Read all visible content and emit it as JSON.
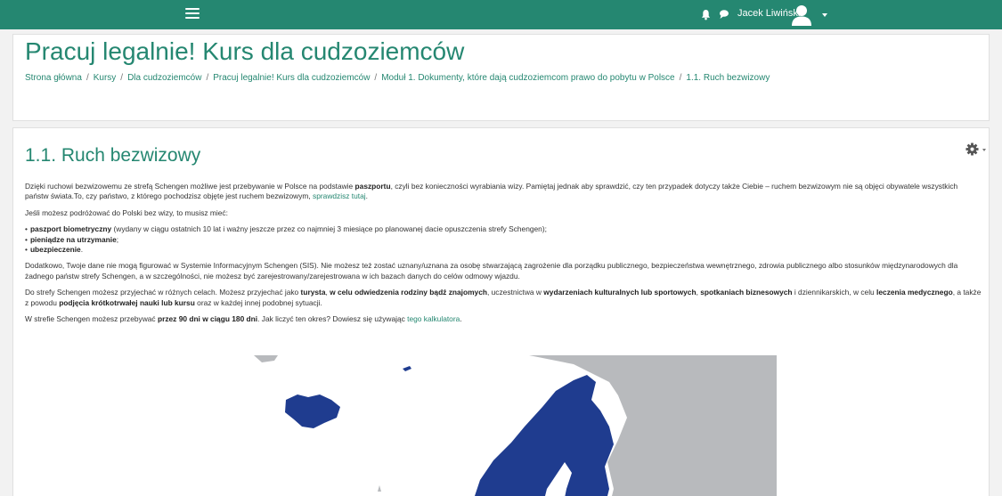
{
  "topbar": {
    "menu_icon": "hamburger-menu-icon",
    "user_name": "Jacek Liwiński",
    "icons": [
      "bell-icon",
      "chat-icon",
      "user-avatar-icon",
      "caret-down-icon"
    ]
  },
  "header": {
    "title": "Pracuj legalnie! Kurs dla cudzoziemców",
    "breadcrumb": [
      "Strona główna",
      "Kursy",
      "Dla cudzoziemców",
      "Pracuj legalnie! Kurs dla cudzoziemców",
      "Moduł 1. Dokumenty, które dają cudzoziemcom prawo do pobytu w Polsce",
      "1.1. Ruch bezwizowy"
    ],
    "separator": "/"
  },
  "content": {
    "title": "1.1. Ruch bezwizowy",
    "p1": {
      "t1": "Dzięki ruchowi bezwizowemu ze strefą Schengen możliwe jest przebywanie w Polsce na podstawie ",
      "b1": "paszportu",
      "t2": ", czyli bez konieczności wyrabiania wizy. Pamiętaj jednak aby sprawdzić, czy ten przypadek dotyczy także Ciebie – ruchem bezwizowym nie są objęci obywatele wszystkich państw świata.To, czy państwo, z którego pochodzisz objęte jest ruchem bezwizowym, ",
      "link": "sprawdzisz tutaj",
      "t3": "."
    },
    "p2": "Jeśli możesz podróżować do Polski bez wizy, to musisz mieć:",
    "list": {
      "i1_b": "paszport biometryczny",
      "i1_t": " (wydany w ciągu ostatnich 10 lat i ważny jeszcze przez co najmniej 3 miesiące po planowanej dacie opuszczenia strefy Schengen);",
      "i2_b": "pieniądze na utrzymanie",
      "i2_t": ";",
      "i3_b": "ubezpieczenie",
      "i3_t": "."
    },
    "p3": "Dodatkowo, Twoje dane nie mogą figurować w Systemie Informacyjnym Schengen (SIS). Nie możesz też zostać uznany/uznana za osobę stwarzającą zagrożenie dla porządku publicznego, bezpieczeństwa wewnętrznego, zdrowia publicznego albo stosunków międzynarodowych dla żadnego państw strefy Schengen, a w szczególności, nie możesz być zarejestrowany/zarejestrowana w ich bazach danych do celów odmowy wjazdu.",
    "p4": {
      "t1": "Do strefy Schengen możesz przyjechać w różnych celach. Możesz przyjechać jako ",
      "b1": "turysta",
      "t2": ", ",
      "b2": "w celu odwiedzenia rodziny bądź znajomych",
      "t3": ", uczestnictwa w ",
      "b3": "wydarzeniach kulturalnych lub sportowych",
      "t4": ", ",
      "b4": "spotkaniach biznesowych",
      "t5": " i dziennikarskich, w celu ",
      "b5": "leczenia medycznego",
      "t6": ", a także z powodu ",
      "b6": "podjęcia krótkotrwałej nauki lub kursu",
      "t7": " oraz w każdej innej podobnej sytuacji."
    },
    "p5": {
      "t1": "W strefie Schengen możesz przebywać ",
      "b1": "przez 90 dni w ciągu 180 dni",
      "t2": ". Jak liczyć ten okres? Dowiesz się używając ",
      "link": "tego kalkulatora",
      "t3": "."
    },
    "map": {
      "land_color": "#1f3c8f",
      "other_color": "#b8babd",
      "sea_color": "#ffffff"
    }
  },
  "colors": {
    "brand": "#258771",
    "background": "#f2f2f2"
  }
}
